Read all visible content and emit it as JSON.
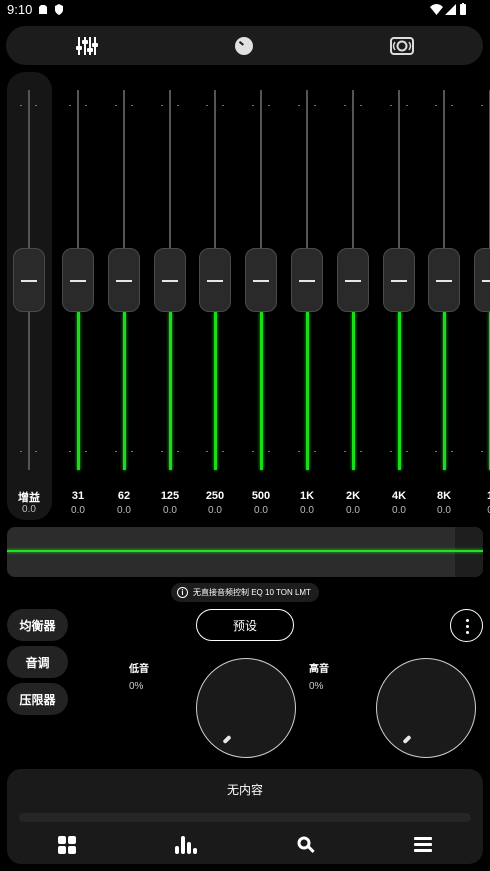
{
  "status_bar": {
    "time": "9:10"
  },
  "tabs": [
    {
      "name": "equalizer",
      "icon": "equalizer-sliders-icon"
    },
    {
      "name": "dial",
      "icon": "dial-icon"
    },
    {
      "name": "speaker",
      "icon": "speaker-icon"
    }
  ],
  "gain": {
    "label": "增益",
    "value": "0.0"
  },
  "bands": [
    {
      "label": "31",
      "value": "0.0"
    },
    {
      "label": "62",
      "value": "0.0"
    },
    {
      "label": "125",
      "value": "0.0"
    },
    {
      "label": "250",
      "value": "0.0"
    },
    {
      "label": "500",
      "value": "0.0"
    },
    {
      "label": "1K",
      "value": "0.0"
    },
    {
      "label": "2K",
      "value": "0.0"
    },
    {
      "label": "4K",
      "value": "0.0"
    },
    {
      "label": "8K",
      "value": "0.0"
    },
    {
      "label": "1",
      "value": "0"
    }
  ],
  "info_text": "无直接音频控制 EQ 10 TON LMT",
  "side_buttons": {
    "equalizer": "均衡器",
    "tone": "音调",
    "limiter": "压限器"
  },
  "preset_label": "预设",
  "bass": {
    "label": "低音",
    "value": "0%"
  },
  "treble": {
    "label": "高音",
    "value": "0%"
  },
  "player": {
    "title": "无内容"
  },
  "colors": {
    "accent": "#1bdc1b",
    "background": "#000000",
    "panel": "#1c1c1c"
  }
}
